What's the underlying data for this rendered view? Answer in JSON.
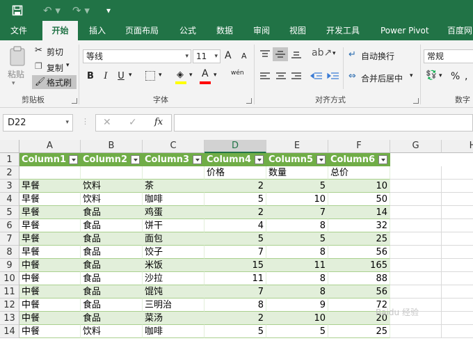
{
  "quick_access": {
    "save_icon": "save-icon",
    "undo_icon": "undo-icon",
    "redo_icon": "redo-icon",
    "customize": "▾"
  },
  "tabs": [
    "文件",
    "开始",
    "插入",
    "页面布局",
    "公式",
    "数据",
    "审阅",
    "视图",
    "开发工具",
    "Power Pivot",
    "百度网"
  ],
  "active_tab": "开始",
  "clipboard": {
    "paste": "粘贴",
    "cut": "剪切",
    "copy": "复制",
    "format_painter": "格式刷",
    "group": "剪贴板"
  },
  "font": {
    "name": "等线",
    "size": "11",
    "bold": "B",
    "italic": "I",
    "underline": "U",
    "grow": "A",
    "shrink": "A",
    "group": "字体",
    "wen": "wén"
  },
  "alignment": {
    "wrap": "自动换行",
    "merge": "合并后居中",
    "group": "对齐方式"
  },
  "number": {
    "format": "常规",
    "percent": "%",
    "group": "数字"
  },
  "formula_bar": {
    "name_box": "D22",
    "cancel": "✕",
    "enter": "✓",
    "fx": "fx",
    "value": ""
  },
  "columns": [
    "A",
    "B",
    "C",
    "D",
    "E",
    "F",
    "G",
    "H"
  ],
  "selected_column": "D",
  "headers": [
    "Column1",
    "Column2",
    "Column3",
    "Column4",
    "Column5",
    "Column6"
  ],
  "row2": [
    "",
    "",
    "",
    "价格",
    "数量",
    "总价"
  ],
  "rows": [
    [
      "早餐",
      "饮料",
      "茶",
      "2",
      "5",
      "10"
    ],
    [
      "早餐",
      "饮料",
      "咖啡",
      "5",
      "10",
      "50"
    ],
    [
      "早餐",
      "食品",
      "鸡蛋",
      "2",
      "7",
      "14"
    ],
    [
      "早餐",
      "食品",
      "饼干",
      "4",
      "8",
      "32"
    ],
    [
      "早餐",
      "食品",
      "面包",
      "5",
      "5",
      "25"
    ],
    [
      "早餐",
      "食品",
      "饺子",
      "7",
      "8",
      "56"
    ],
    [
      "中餐",
      "食品",
      "米饭",
      "15",
      "11",
      "165"
    ],
    [
      "中餐",
      "食品",
      "沙拉",
      "11",
      "8",
      "88"
    ],
    [
      "中餐",
      "食品",
      "馄饨",
      "7",
      "8",
      "56"
    ],
    [
      "中餐",
      "食品",
      "三明治",
      "8",
      "9",
      "72"
    ],
    [
      "中餐",
      "食品",
      "菜汤",
      "2",
      "10",
      "20"
    ],
    [
      "中餐",
      "饮料",
      "咖啡",
      "5",
      "5",
      "25"
    ]
  ],
  "row_numbers": [
    "1",
    "2",
    "3",
    "4",
    "5",
    "6",
    "7",
    "8",
    "9",
    "10",
    "11",
    "12",
    "13",
    "14"
  ],
  "watermark": "Baidu 经验",
  "colors": {
    "excel_green": "#217346",
    "table_header": "#70ad47",
    "band": "#e2efda"
  }
}
